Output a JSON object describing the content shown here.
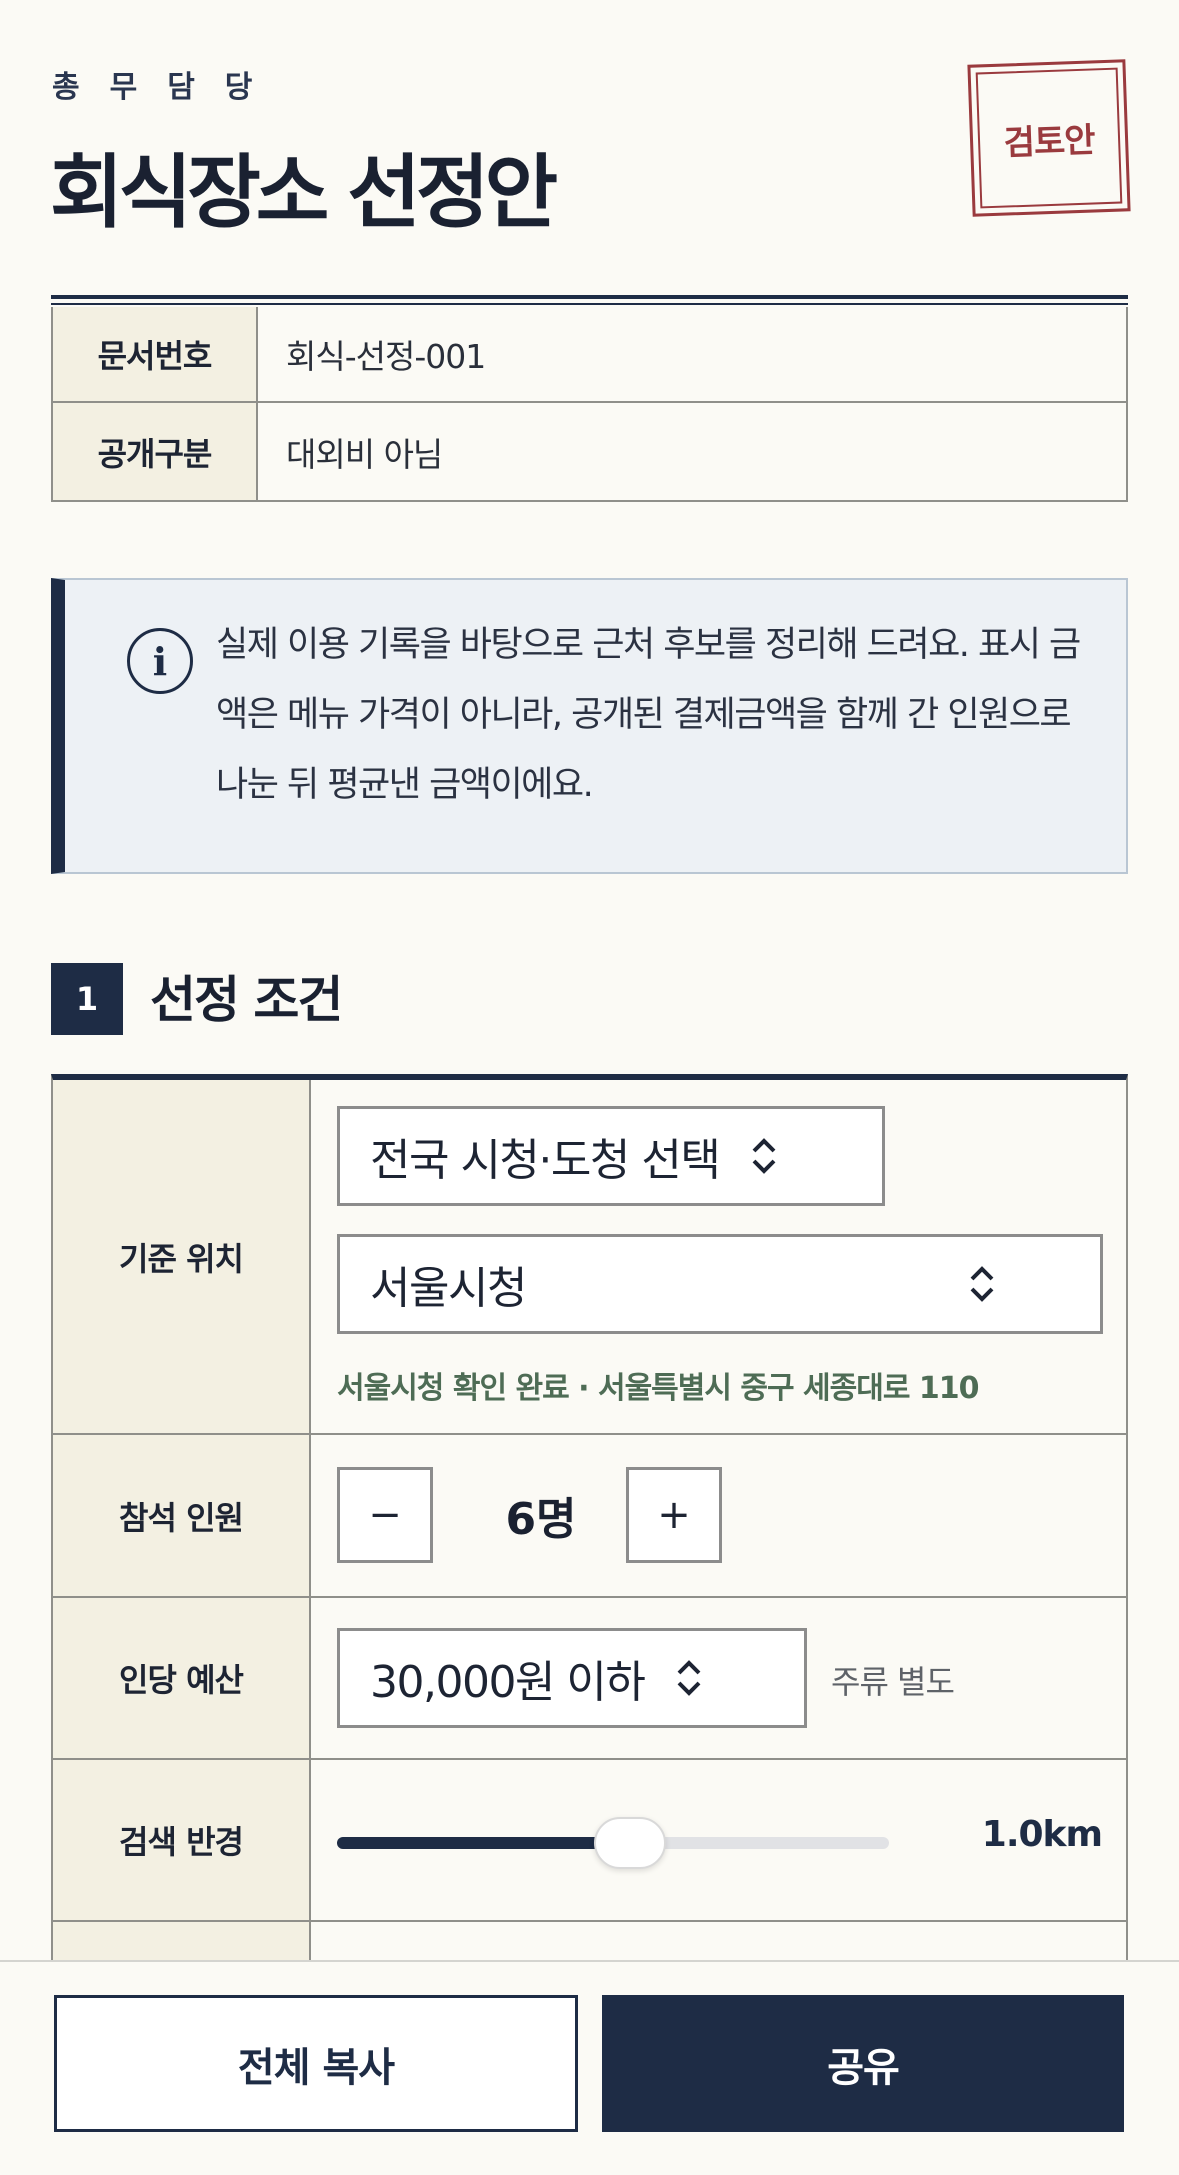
{
  "header": {
    "department": "총무담당",
    "title": "회식장소 선정안",
    "stamp": "검토안"
  },
  "meta": {
    "rows": [
      {
        "key": "문서번호",
        "value": "회식-선정-001"
      },
      {
        "key": "공개구분",
        "value": "대외비 아님"
      }
    ]
  },
  "notice": {
    "icon": "info-icon",
    "text": "실제 이용 기록을 바탕으로 근처 후보를 정리해 드려요. 표시 금액은 메뉴 가격이 아니라, 공개된 결제금액을 함께 간 인원으로 나눈 뒤 평균낸 금액이에요."
  },
  "section": {
    "number": "1",
    "title": "선정 조건"
  },
  "conditions": {
    "location": {
      "label": "기준 위치",
      "region_select": "전국 시청·도청 선택",
      "office_select": "서울시청",
      "confirm": "서울시청 확인 완료 · 서울특별시 중구 세종대로 110"
    },
    "headcount": {
      "label": "참석 인원",
      "minus": "−",
      "value": "6명",
      "plus": "+"
    },
    "budget": {
      "label": "인당 예산",
      "select": "30,000원 이하",
      "note": "주류 별도"
    },
    "radius": {
      "label": "검색 반경",
      "value": "1.0km",
      "fill_fraction": 0.53
    }
  },
  "actions": {
    "copy": "전체 복사",
    "share": "공유"
  },
  "colors": {
    "navy": "#1e2c45",
    "stamp_red": "#9a3a3e",
    "confirm_green": "#4e6c55",
    "key_bg": "#f3f0e2",
    "page_bg": "#fbfaf5"
  }
}
